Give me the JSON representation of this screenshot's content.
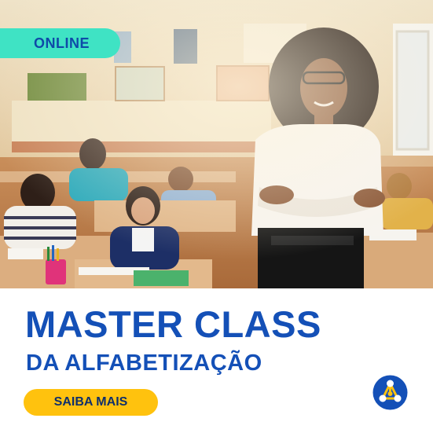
{
  "badge": {
    "label": "ONLINE"
  },
  "headline": {
    "title": "MASTER CLASS",
    "subtitle": "DA ALFABETIZAÇÃO"
  },
  "cta": {
    "label": "SAIBA MAIS"
  },
  "logo": {
    "icon": "molecule-logo-icon"
  },
  "colors": {
    "brand_blue": "#1450b7",
    "badge_teal": "#3fe3c4",
    "cta_yellow": "#ffc20e"
  }
}
